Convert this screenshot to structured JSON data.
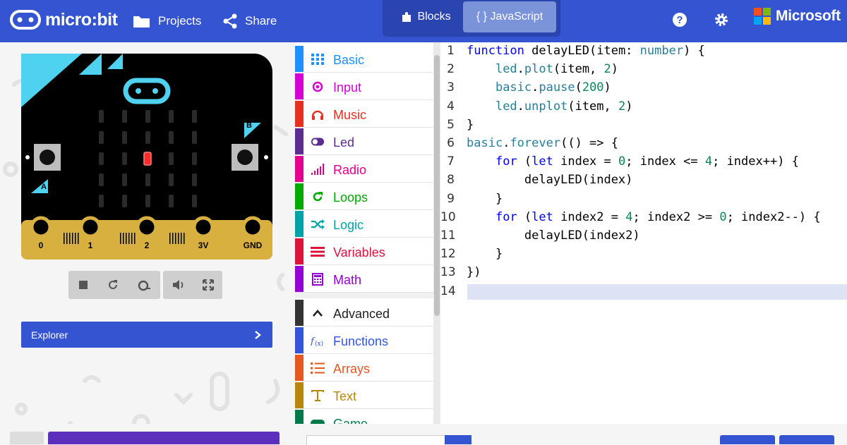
{
  "header": {
    "logo_text": "micro:bit",
    "projects_label": "Projects",
    "share_label": "Share",
    "blocks_label": "Blocks",
    "javascript_label": "{ } JavaScript",
    "help_icon": "help-icon",
    "settings_icon": "gear-icon",
    "microsoft_label": "Microsoft",
    "accent": "#3454d1"
  },
  "simulator": {
    "pins": [
      "0",
      "1",
      "2",
      "3V",
      "GND"
    ],
    "button_a": "A",
    "button_b": "B",
    "lit_led": "row 3, col 3",
    "controls": [
      "stop-icon",
      "restart-icon",
      "slow-mo-icon",
      "mute-icon",
      "fullscreen-icon"
    ]
  },
  "explorer": {
    "label": "Explorer"
  },
  "toolbox": {
    "items": [
      {
        "label": "Basic",
        "color": "#1e90ff"
      },
      {
        "label": "Input",
        "color": "#d400d4"
      },
      {
        "label": "Music",
        "color": "#e63022"
      },
      {
        "label": "Led",
        "color": "#5c2d91"
      },
      {
        "label": "Radio",
        "color": "#e3008c"
      },
      {
        "label": "Loops",
        "color": "#00aa00"
      },
      {
        "label": "Logic",
        "color": "#00a4a6"
      },
      {
        "label": "Variables",
        "color": "#dc143c"
      },
      {
        "label": "Math",
        "color": "#9400d3"
      }
    ],
    "advanced_label": "Advanced",
    "advanced_items": [
      {
        "label": "Functions",
        "color": "#3455db"
      },
      {
        "label": "Arrays",
        "color": "#e65722"
      },
      {
        "label": "Text",
        "color": "#b8860b"
      },
      {
        "label": "Game",
        "color": "#007a4b"
      }
    ]
  },
  "code": {
    "lines": [
      "function delayLED(item: number) {",
      "    led.plot(item, 2)",
      "    basic.pause(200)",
      "    led.unplot(item, 2)",
      "}",
      "basic.forever(() => {",
      "    for (let index = 0; index <= 4; index++) {",
      "        delayLED(index)",
      "    }",
      "    for (let index2 = 4; index2 >= 0; index2--) {",
      "        delayLED(index2)",
      "    }",
      "})",
      ""
    ],
    "line_numbers": [
      "1",
      "2",
      "3",
      "4",
      "5",
      "6",
      "7",
      "8",
      "9",
      "10",
      "11",
      "12",
      "13",
      "14"
    ]
  }
}
